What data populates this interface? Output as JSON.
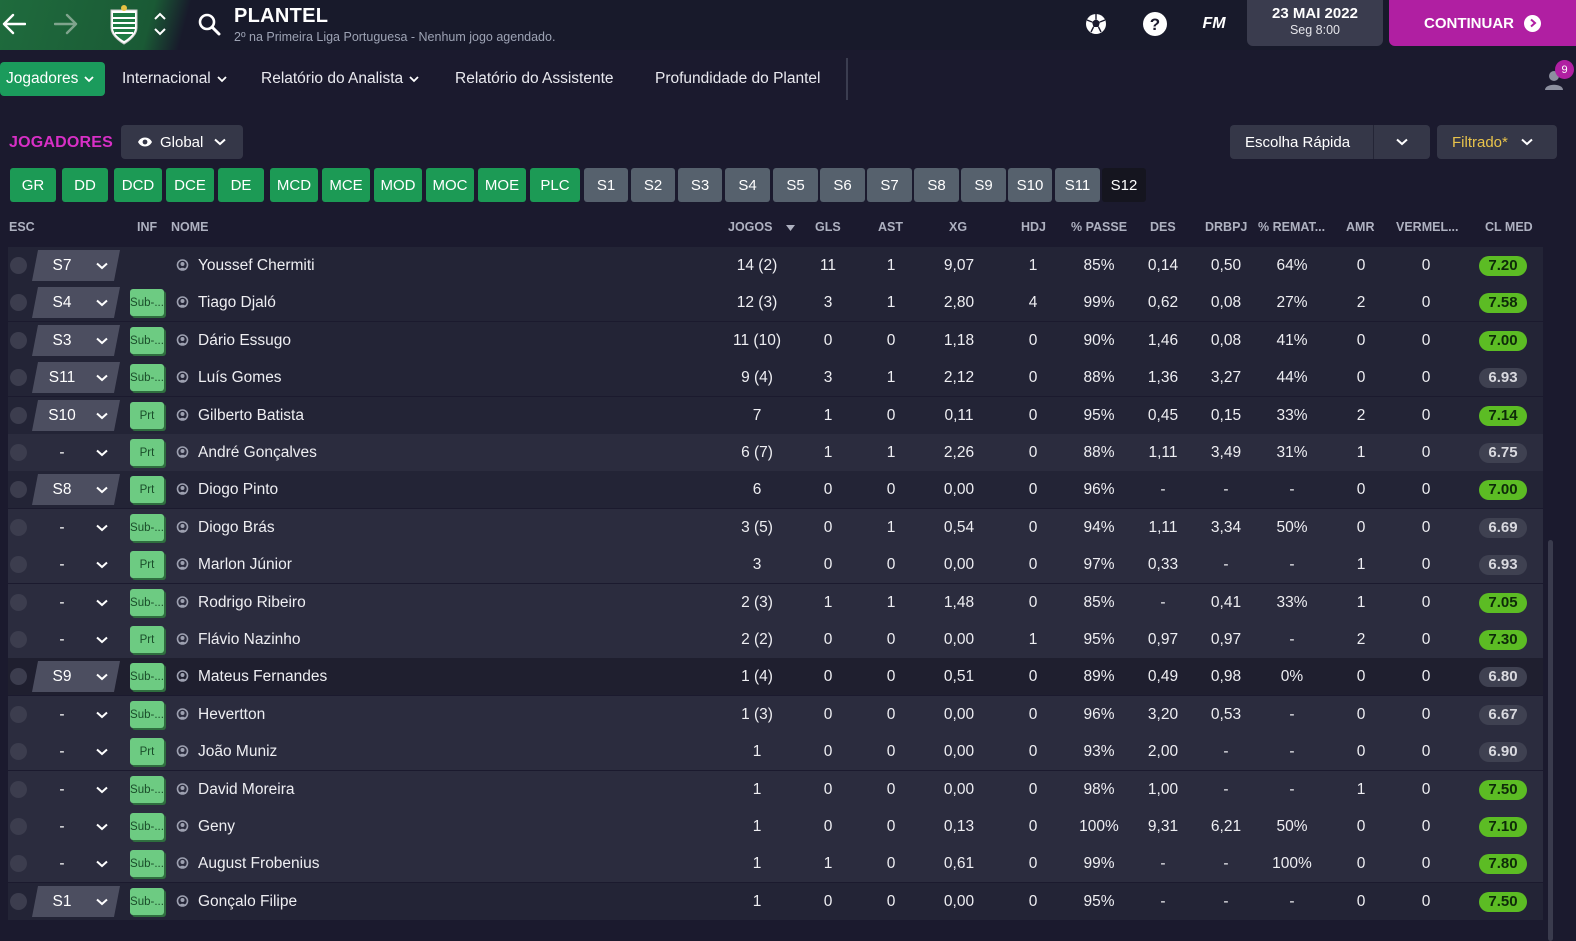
{
  "header": {
    "title": "PLANTEL",
    "subtitle": "2º na Primeira Liga Portuguesa - Nenhum jogo agendado.",
    "fm_label": "FM",
    "date_main": "23 MAI 2022",
    "date_sub": "Seg 8:00",
    "continue_label": "CONTINUAR"
  },
  "nav": {
    "items": [
      {
        "label": "Jogadores"
      },
      {
        "label": "Internacional"
      },
      {
        "label": "Relatório do Analista"
      },
      {
        "label": "Relatório do Assistente"
      },
      {
        "label": "Profundidade do Plantel"
      }
    ],
    "notification_count": "9"
  },
  "section": {
    "title": "JOGADORES",
    "view": "Global",
    "quick_pick": "Escolha Rápida",
    "filter": "Filtrado*"
  },
  "chips": [
    "GR",
    "DD",
    "DCD",
    "DCE",
    "DE",
    "MCD",
    "MCE",
    "MOD",
    "MOC",
    "MOE",
    "PLC",
    "S1",
    "S2",
    "S3",
    "S4",
    "S5",
    "S6",
    "S7",
    "S8",
    "S9",
    "S10",
    "S11",
    "S12"
  ],
  "columns": {
    "esc": "ESC",
    "inf": "INF",
    "nome": "NOME",
    "jogos": "JOGOS",
    "gls": "GLS",
    "ast": "AST",
    "xg": "XG",
    "hdj": "HDJ",
    "passe": "% PASSE",
    "des": "DES",
    "drbpj": "DRBPJ",
    "remat": "% REMAT...",
    "amr": "AMR",
    "verm": "VERMEL...",
    "clmed": "CL MED"
  },
  "players": [
    {
      "esc": "S7",
      "inf": "",
      "name": "Youssef Chermiti",
      "jogos": "14 (2)",
      "gls": "11",
      "ast": "1",
      "xg": "9,07",
      "hdj": "1",
      "passe": "85%",
      "des": "0,14",
      "drbpj": "0,50",
      "remat": "64%",
      "amr": "0",
      "verm": "0",
      "cl": "7.20",
      "cl_color": "green"
    },
    {
      "esc": "S4",
      "inf": "Sub-...",
      "name": "Tiago Djaló",
      "jogos": "12 (3)",
      "gls": "3",
      "ast": "1",
      "xg": "2,80",
      "hdj": "4",
      "passe": "99%",
      "des": "0,62",
      "drbpj": "0,08",
      "remat": "27%",
      "amr": "2",
      "verm": "0",
      "cl": "7.58",
      "cl_color": "green"
    },
    {
      "esc": "S3",
      "inf": "Sub-...",
      "name": "Dário Essugo",
      "jogos": "11 (10)",
      "gls": "0",
      "ast": "0",
      "xg": "1,18",
      "hdj": "0",
      "passe": "90%",
      "des": "1,46",
      "drbpj": "0,08",
      "remat": "41%",
      "amr": "0",
      "verm": "0",
      "cl": "7.00",
      "cl_color": "green"
    },
    {
      "esc": "S11",
      "inf": "Sub-...",
      "name": "Luís Gomes",
      "jogos": "9 (4)",
      "gls": "3",
      "ast": "1",
      "xg": "2,12",
      "hdj": "0",
      "passe": "88%",
      "des": "1,36",
      "drbpj": "3,27",
      "remat": "44%",
      "amr": "0",
      "verm": "0",
      "cl": "6.93",
      "cl_color": "grey"
    },
    {
      "esc": "S10",
      "inf": "Prt",
      "name": "Gilberto Batista",
      "jogos": "7",
      "gls": "1",
      "ast": "0",
      "xg": "0,11",
      "hdj": "0",
      "passe": "95%",
      "des": "0,45",
      "drbpj": "0,15",
      "remat": "33%",
      "amr": "2",
      "verm": "0",
      "cl": "7.14",
      "cl_color": "green"
    },
    {
      "esc": "-",
      "inf": "Prt",
      "name": "André Gonçalves",
      "jogos": "6 (7)",
      "gls": "1",
      "ast": "1",
      "xg": "2,26",
      "hdj": "0",
      "passe": "88%",
      "des": "1,11",
      "drbpj": "3,49",
      "remat": "31%",
      "amr": "1",
      "verm": "0",
      "cl": "6.75",
      "cl_color": "grey"
    },
    {
      "esc": "S8",
      "inf": "Prt",
      "name": "Diogo Pinto",
      "jogos": "6",
      "gls": "0",
      "ast": "0",
      "xg": "0,00",
      "hdj": "0",
      "passe": "96%",
      "des": "-",
      "drbpj": "-",
      "remat": "-",
      "amr": "0",
      "verm": "0",
      "cl": "7.00",
      "cl_color": "green"
    },
    {
      "esc": "-",
      "inf": "Sub-...",
      "name": "Diogo Brás",
      "jogos": "3 (5)",
      "gls": "0",
      "ast": "1",
      "xg": "0,54",
      "hdj": "0",
      "passe": "94%",
      "des": "1,11",
      "drbpj": "3,34",
      "remat": "50%",
      "amr": "0",
      "verm": "0",
      "cl": "6.69",
      "cl_color": "grey"
    },
    {
      "esc": "-",
      "inf": "Prt",
      "name": "Marlon Júnior",
      "jogos": "3",
      "gls": "0",
      "ast": "0",
      "xg": "0,00",
      "hdj": "0",
      "passe": "97%",
      "des": "0,33",
      "drbpj": "-",
      "remat": "-",
      "amr": "1",
      "verm": "0",
      "cl": "6.93",
      "cl_color": "grey"
    },
    {
      "esc": "-",
      "inf": "Sub-...",
      "name": "Rodrigo Ribeiro",
      "jogos": "2 (3)",
      "gls": "1",
      "ast": "1",
      "xg": "1,48",
      "hdj": "0",
      "passe": "85%",
      "des": "-",
      "drbpj": "0,41",
      "remat": "33%",
      "amr": "1",
      "verm": "0",
      "cl": "7.05",
      "cl_color": "green"
    },
    {
      "esc": "-",
      "inf": "Prt",
      "name": "Flávio Nazinho",
      "jogos": "2 (2)",
      "gls": "0",
      "ast": "0",
      "xg": "0,00",
      "hdj": "1",
      "passe": "95%",
      "des": "0,97",
      "drbpj": "0,97",
      "remat": "-",
      "amr": "2",
      "verm": "0",
      "cl": "7.30",
      "cl_color": "green"
    },
    {
      "esc": "S9",
      "inf": "Sub-...",
      "name": "Mateus Fernandes",
      "jogos": "1 (4)",
      "gls": "0",
      "ast": "0",
      "xg": "0,51",
      "hdj": "0",
      "passe": "89%",
      "des": "0,49",
      "drbpj": "0,98",
      "remat": "0%",
      "amr": "0",
      "verm": "0",
      "cl": "6.80",
      "cl_color": "grey"
    },
    {
      "esc": "-",
      "inf": "Sub-...",
      "name": "Hevertton",
      "jogos": "1 (3)",
      "gls": "0",
      "ast": "0",
      "xg": "0,00",
      "hdj": "0",
      "passe": "96%",
      "des": "3,20",
      "drbpj": "0,53",
      "remat": "-",
      "amr": "0",
      "verm": "0",
      "cl": "6.67",
      "cl_color": "grey"
    },
    {
      "esc": "-",
      "inf": "Prt",
      "name": "João Muniz",
      "jogos": "1",
      "gls": "0",
      "ast": "0",
      "xg": "0,00",
      "hdj": "0",
      "passe": "93%",
      "des": "2,00",
      "drbpj": "-",
      "remat": "-",
      "amr": "0",
      "verm": "0",
      "cl": "6.90",
      "cl_color": "grey"
    },
    {
      "esc": "-",
      "inf": "Sub-...",
      "name": "David Moreira",
      "jogos": "1",
      "gls": "0",
      "ast": "0",
      "xg": "0,00",
      "hdj": "0",
      "passe": "98%",
      "des": "1,00",
      "drbpj": "-",
      "remat": "-",
      "amr": "1",
      "verm": "0",
      "cl": "7.50",
      "cl_color": "green"
    },
    {
      "esc": "-",
      "inf": "Sub-...",
      "name": "Geny",
      "jogos": "1",
      "gls": "0",
      "ast": "0",
      "xg": "0,13",
      "hdj": "0",
      "passe": "100%",
      "des": "9,31",
      "drbpj": "6,21",
      "remat": "50%",
      "amr": "0",
      "verm": "0",
      "cl": "7.10",
      "cl_color": "green"
    },
    {
      "esc": "-",
      "inf": "Sub-...",
      "name": "August Frobenius",
      "jogos": "1",
      "gls": "1",
      "ast": "0",
      "xg": "0,61",
      "hdj": "0",
      "passe": "99%",
      "des": "-",
      "drbpj": "-",
      "remat": "100%",
      "amr": "0",
      "verm": "0",
      "cl": "7.80",
      "cl_color": "green"
    },
    {
      "esc": "S1",
      "inf": "Sub-...",
      "name": "Gonçalo Filipe",
      "jogos": "1",
      "gls": "0",
      "ast": "0",
      "xg": "0,00",
      "hdj": "0",
      "passe": "95%",
      "des": "-",
      "drbpj": "-",
      "remat": "-",
      "amr": "0",
      "verm": "0",
      "cl": "7.50",
      "cl_color": "green"
    }
  ],
  "colors": {
    "accent_magenta": "#b01fa2",
    "position_green": "#1c9a55",
    "rating_green": "#5cbc24",
    "rating_grey": "#3f4151",
    "filter_gold": "#e8c34b"
  }
}
